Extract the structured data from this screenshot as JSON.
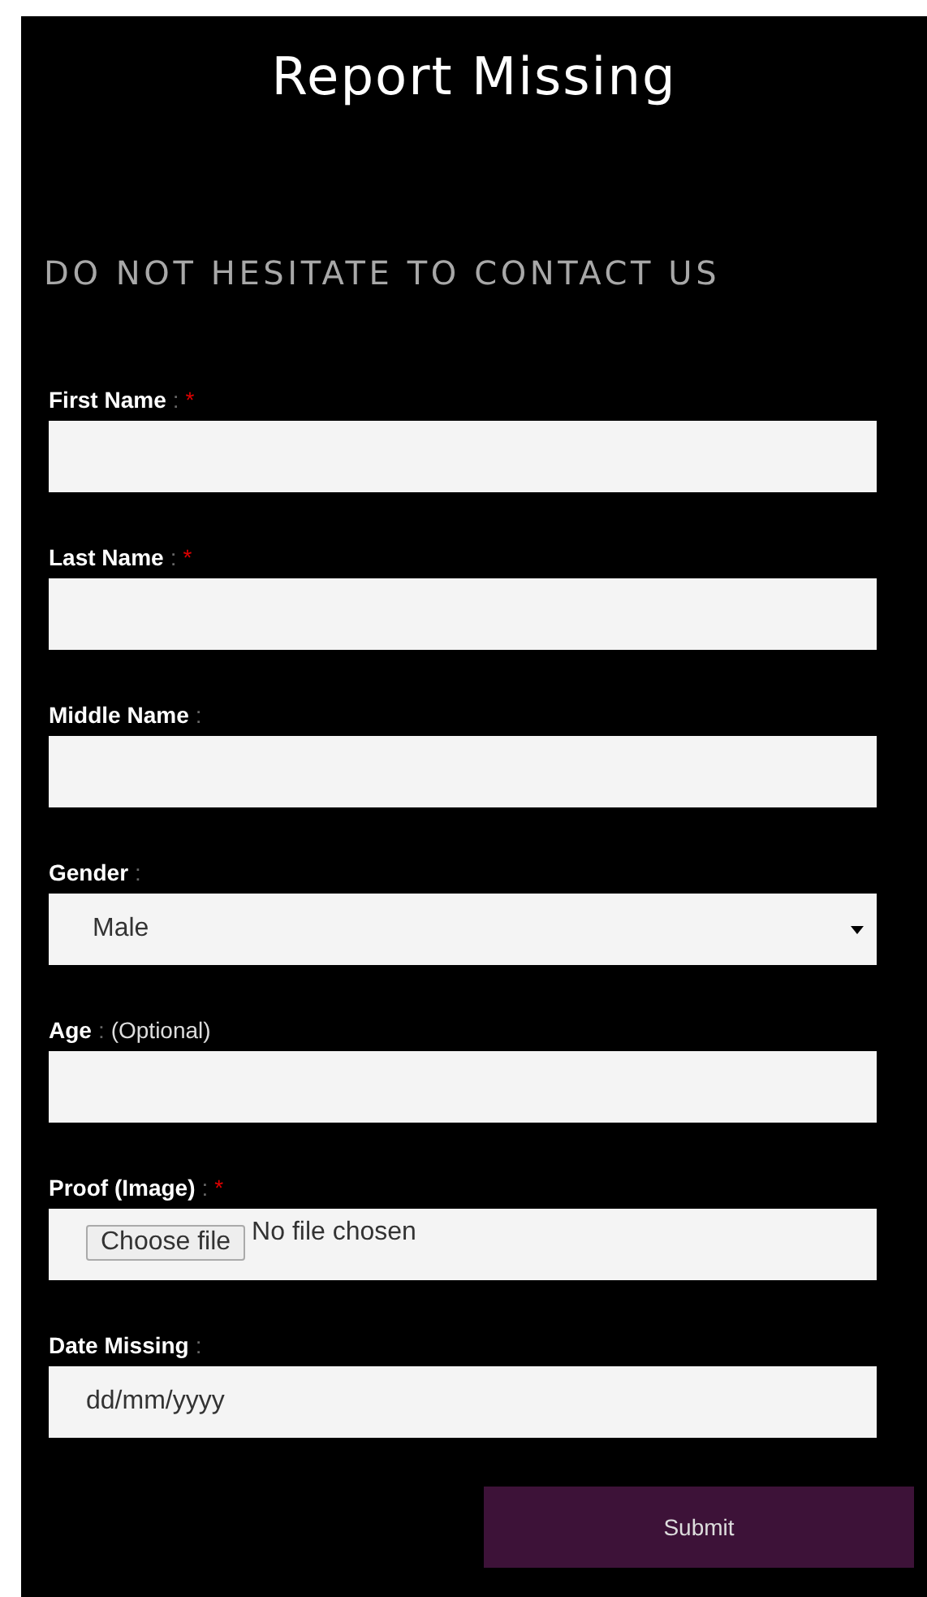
{
  "title": "Report Missing",
  "subtitle": "DO NOT HESITATE TO CONTACT US",
  "fields": [
    {
      "kind": "text",
      "label": "First Name",
      "separator": ":",
      "mark": "*"
    },
    {
      "kind": "text",
      "label": "Last Name",
      "separator": ":",
      "mark": "*"
    },
    {
      "kind": "text",
      "label": "Middle Name",
      "separator": ":"
    },
    {
      "kind": "select",
      "label": "Gender",
      "separator": ":",
      "value": "Male"
    },
    {
      "kind": "text",
      "label": "Age",
      "separator": ":",
      "hint": "(Optional)"
    },
    {
      "kind": "file",
      "label": "Proof (Image)",
      "separator": ":",
      "mark": "*",
      "button": "Choose file",
      "status": "No file chosen"
    },
    {
      "kind": "date",
      "label": "Date Missing",
      "separator": ":",
      "placeholder": "dd/mm/yyyy"
    }
  ],
  "submit": "Submit"
}
